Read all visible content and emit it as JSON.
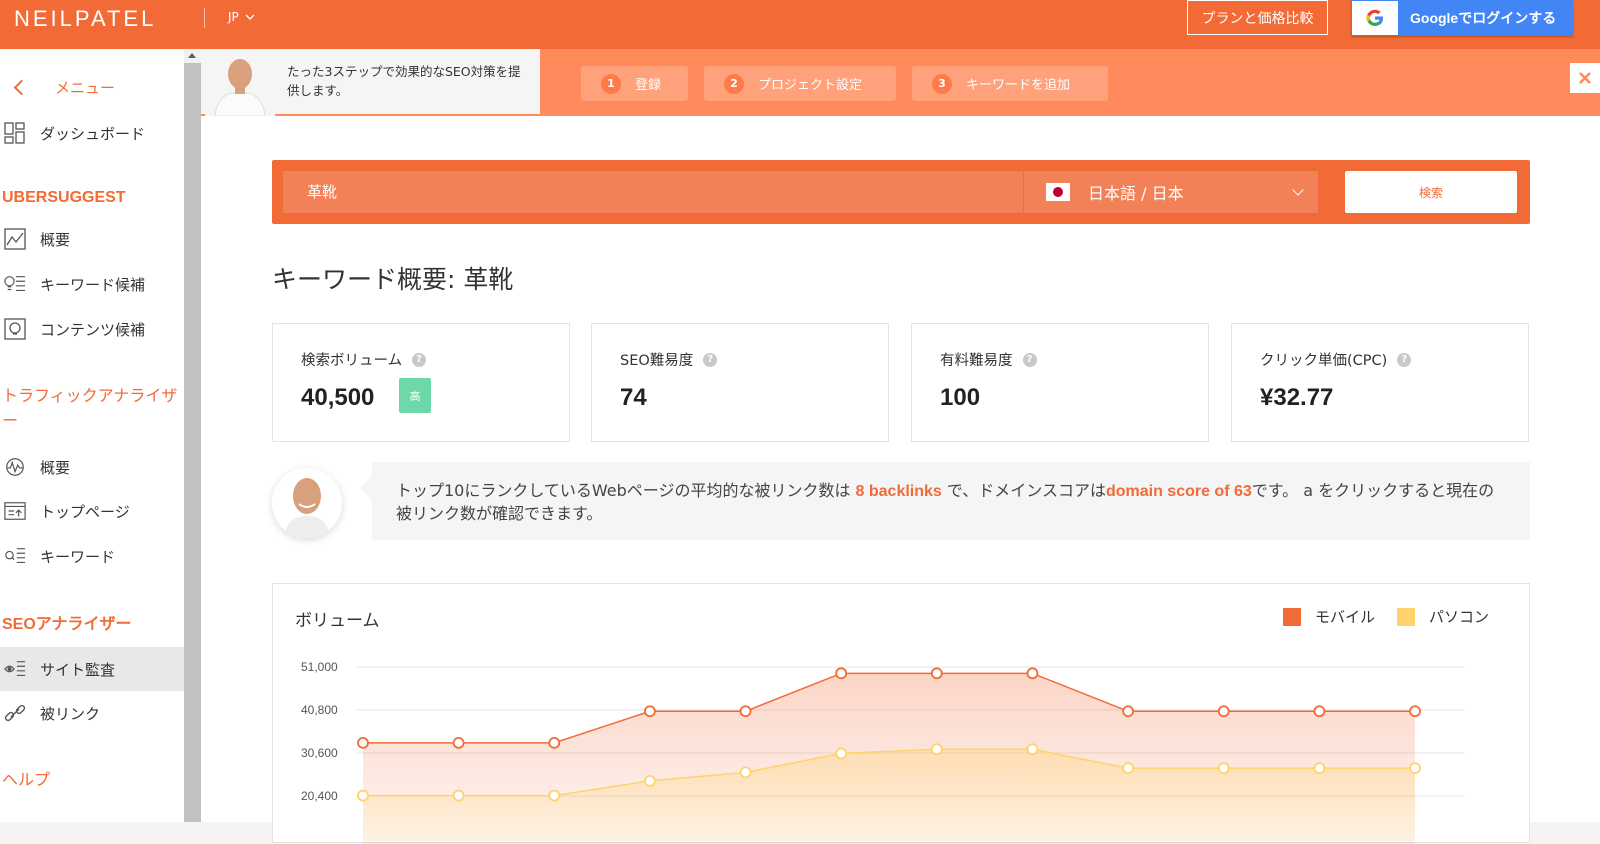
{
  "header": {
    "logo": "NEILPATEL",
    "lang": "JP",
    "plan_button": "プランと価格比較",
    "google_button": "Googleでログインする"
  },
  "sidebar": {
    "menu_label": "メニュー",
    "dashboard": "ダッシュボード",
    "section_ubersuggest": "UBERSUGGEST",
    "ubersuggest_items": [
      "概要",
      "キーワード候補",
      "コンテンツ候補"
    ],
    "section_traffic": "トラフィックアナライザー",
    "traffic_items": [
      "概要",
      "トップページ",
      "キーワード"
    ],
    "section_seo": "SEOアナライザー",
    "seo_items": [
      "サイト監査",
      "被リンク"
    ],
    "section_help": "ヘルプ"
  },
  "banner": {
    "text": "たった3ステップで効果的なSEO対策を提供します。",
    "steps": [
      {
        "num": "1",
        "label": "登録"
      },
      {
        "num": "2",
        "label": "プロジェクト設定"
      },
      {
        "num": "3",
        "label": "キーワードを追加"
      }
    ]
  },
  "search": {
    "query": "革靴",
    "language": "日本語 / 日本",
    "button": "検索"
  },
  "overview": {
    "title": "キーワード概要: 革靴",
    "cards": [
      {
        "label": "検索ボリューム",
        "value": "40,500",
        "badge": "高"
      },
      {
        "label": "SEO難易度",
        "value": "74"
      },
      {
        "label": "有料難易度",
        "value": "100"
      },
      {
        "label": "クリック単価(CPC)",
        "value": "¥32.77"
      }
    ]
  },
  "tip": {
    "part1": "トップ10にランクしているWebページの平均的な被リンク数は ",
    "hl1": "8 backlinks",
    "part2": " で、ドメインスコアは",
    "hl2": "domain score of 63",
    "part3": "です。 a をクリックすると現在の被リンク数が確認できます。"
  },
  "colors": {
    "brand": "#f26a36",
    "mobile": "#f26a36",
    "desktop": "#ffd36b"
  },
  "chart_data": {
    "type": "area",
    "title": "ボリューム",
    "y_ticks": [
      "51,000",
      "40,800",
      "30,600",
      "20,400"
    ],
    "ylim": [
      20400,
      51000
    ],
    "series": [
      {
        "name": "モバイル",
        "values": [
          33000,
          33000,
          33000,
          40500,
          40500,
          49500,
          49500,
          49500,
          40500,
          40500,
          40500,
          40500
        ]
      },
      {
        "name": "パソコン",
        "values": [
          20500,
          20500,
          20500,
          24000,
          26000,
          30500,
          31500,
          31500,
          27000,
          27000,
          27000,
          27000
        ]
      }
    ]
  }
}
